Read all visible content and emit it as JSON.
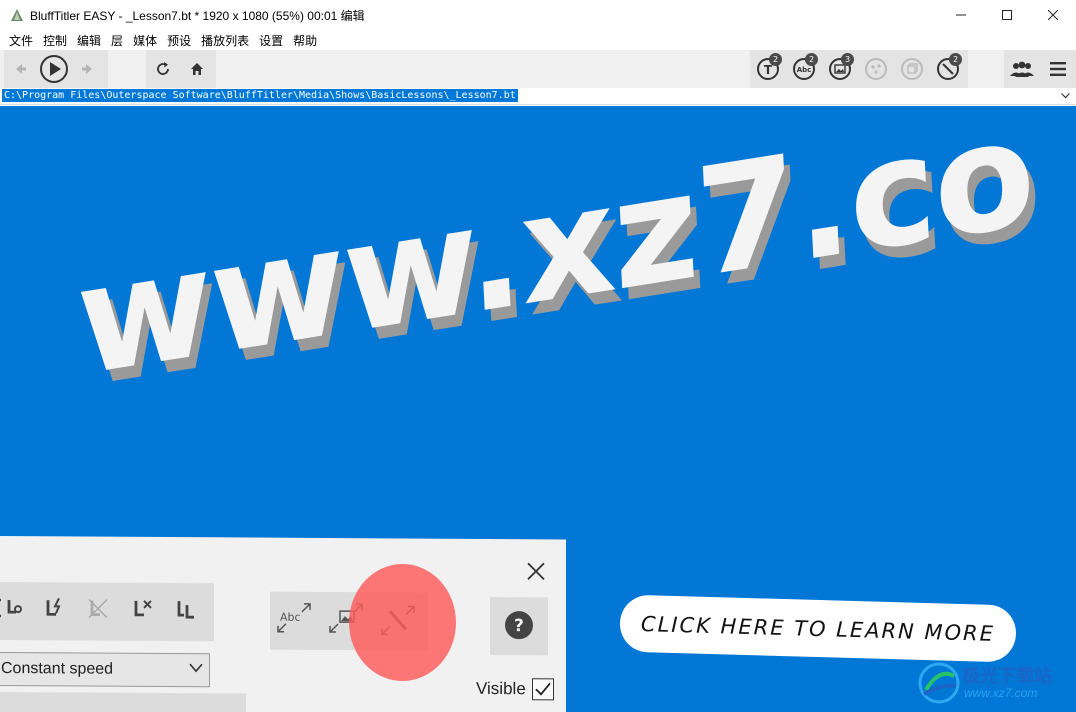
{
  "window": {
    "title": "BluffTitler EASY  - _Lesson7.bt * 1920 x 1080 (55%) 00:01 编辑"
  },
  "menu": {
    "items": [
      "文件",
      "控制",
      "编辑",
      "层",
      "媒体",
      "预设",
      "播放列表",
      "设置",
      "帮助"
    ]
  },
  "toolbar": {
    "nav_icons": [
      "back-arrow-icon",
      "play-icon",
      "forward-arrow-icon"
    ],
    "badges": {
      "text_layers": "2",
      "abc_layers": "2",
      "image_layers": "3",
      "magic_layers": "2"
    }
  },
  "path_bar": {
    "value": "C:\\Program Files\\Outerspace Software\\BluffTitler\\Media\\Shows\\BasicLessons\\_Lesson7.bt"
  },
  "preview": {
    "title_text": "www.xz7.co",
    "background_color": "#0277d6"
  },
  "panel": {
    "speed_value": "Constant speed",
    "visible_label": "Visible",
    "visible_checked": true
  },
  "cta": {
    "label": "CLICK HERE TO LEARN MORE"
  },
  "watermark": {
    "title": "极光下载站",
    "url": "www.xz7.com"
  }
}
